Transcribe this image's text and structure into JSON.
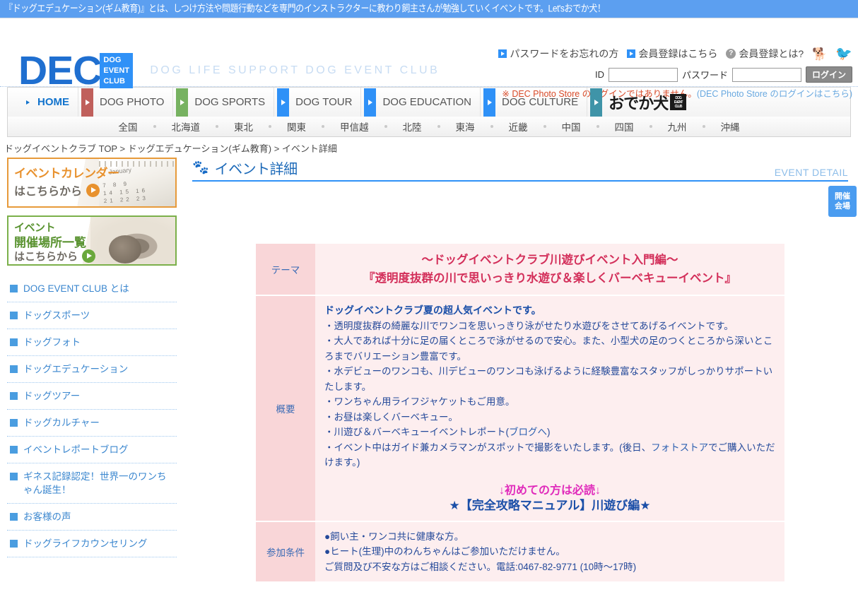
{
  "top_banner": {
    "text": "『ドッグエデュケーション(ギム教育)』とは、しつけ方法や問題行動などを専門のインストラクターに教わり飼主さんが勉強していくイベントです。Let'sおでか犬！"
  },
  "header": {
    "logo_main": "DEC",
    "logo_badge_line1": "DOG",
    "logo_badge_line2": "EVENT",
    "logo_badge_line3": "CLUB",
    "tagline": "DOG LIFE SUPPORT DOG EVENT CLUB",
    "links": [
      {
        "label": "パスワードをお忘れの方",
        "icon": "blue-square-arrow-icon"
      },
      {
        "label": "会員登録はこちら",
        "icon": "blue-square-arrow-icon"
      },
      {
        "label": "会員登録とは?",
        "icon": "question-mark-icon"
      }
    ],
    "dog_icon": "dog-silhouette-icon",
    "twitter_icon": "twitter-bird-icon",
    "id_label": "ID",
    "id_value": "",
    "password_label": "パスワード",
    "password_value": "",
    "login_button": "ログイン",
    "note_prefix": "※ DEC Photo Store のログインではありません。",
    "note_link": "(DEC Photo Store のログインはこちら)"
  },
  "global_nav": [
    {
      "label": "HOME",
      "accent": "#1273cd",
      "active": true
    },
    {
      "label": "DOG PHOTO",
      "accent": "#c0605c"
    },
    {
      "label": "DOG SPORTS",
      "accent": "#77b261"
    },
    {
      "label": "DOG TOUR",
      "accent": "#2f91f7"
    },
    {
      "label": "DOG EDUCATION",
      "accent": "#2f91f7"
    },
    {
      "label": "DOG CULTURE",
      "accent": "#2f91f7"
    },
    {
      "label": "おでか犬",
      "accent": "#3f94a8",
      "is_brand": true
    }
  ],
  "regions": [
    "全国",
    "北海道",
    "東北",
    "関東",
    "甲信越",
    "北陸",
    "東海",
    "近畿",
    "中国",
    "四国",
    "九州",
    "沖縄"
  ],
  "breadcrumb": "ドッグイベントクラブ TOP > ドッグエデュケーション(ギム教育) > イベント詳細",
  "sidebar": {
    "banner_calendar": {
      "line1": "イベントカレンダー",
      "line2": "はこちらから",
      "image_month": "January",
      "image_numbers": "7 8 9\n14 15 16\n21 22 23"
    },
    "banner_venue": {
      "line1": "イベント",
      "line1b": "開催場所一覧",
      "line2": "はこちらから"
    },
    "items": [
      {
        "label": "DOG EVENT CLUB とは"
      },
      {
        "label": "ドッグスポーツ"
      },
      {
        "label": "ドッグフォト"
      },
      {
        "label": "ドッグエデュケーション"
      },
      {
        "label": "ドッグツアー"
      },
      {
        "label": "ドッグカルチャー"
      },
      {
        "label": "イベントレポートブログ"
      },
      {
        "label": "ギネス記録認定！世界一のワンちゃん誕生！"
      },
      {
        "label": "お客様の声"
      },
      {
        "label": "ドッグライフカウンセリング"
      }
    ]
  },
  "content": {
    "heading_icon": "paw-print-icon",
    "heading_ja": "イベント詳細",
    "heading_en": "EVENT DETAIL",
    "side_tab_line1": "開催",
    "side_tab_line2": "会場",
    "rows": {
      "theme": {
        "label": "テーマ",
        "line1": "～ドッグイベントクラブ川遊びイベント入門編～",
        "line2": "『透明度抜群の川で思いっきり水遊び＆楽しくバーベキューイベント』"
      },
      "overview": {
        "label": "概要",
        "lead": "ドッグイベントクラブ夏の超人気イベントです。",
        "lines": [
          "・透明度抜群の綺麗な川でワンコを思いっきり泳がせたり水遊びをさせてあげるイベントです。",
          "・大人であれば十分に足の届くところで泳がせるので安心。また、小型犬の足のつくところから深いところまでバリエーション豊富です。",
          "・水デビューのワンコも、川デビューのワンコも泳げるように経験豊富なスタッフがしっかりサポートいたします。",
          "・ワンちゃん用ライフジャケットもご用意。",
          "・お昼は楽しくバーベキュー。"
        ],
        "line_report_prefix": "・川遊び＆バーベキューイベントレポート(",
        "line_report_link": "ブログへ",
        "line_report_suffix": ")",
        "line_photo_prefix": "・イベント中はガイド兼カメラマンがスポットで撮影をいたします。(後日、",
        "line_photo_link": "フォトストア",
        "line_photo_suffix": "でご購入いただけます。)",
        "cta_line1": "↓初めての方は必読↓",
        "cta_line2_prefix": "★",
        "cta_line2_link": "【完全攻略マニュアル】川遊び編",
        "cta_line2_suffix": "★"
      },
      "conditions": {
        "label": "参加条件",
        "lines": [
          "●飼い主・ワンコ共に健康な方。",
          "●ヒート(生理)中のわんちゃんはご参加いただけません。",
          "ご質問及び不安な方はご相談ください。電話:0467-82-9771 (10時～17時)"
        ]
      }
    }
  }
}
